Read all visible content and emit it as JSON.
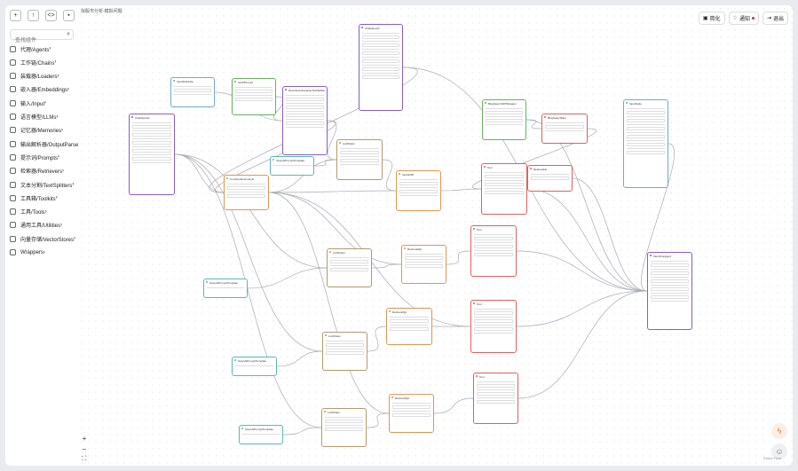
{
  "app": {
    "breadcrumb": "拟股市分析-模拟问题"
  },
  "toolbar_icons": [
    {
      "name": "new-file-icon",
      "glyph": "+"
    },
    {
      "name": "upload-file-icon",
      "glyph": "↑"
    },
    {
      "name": "code-icon",
      "glyph": "<>"
    },
    {
      "name": "save-icon",
      "glyph": "▪"
    }
  ],
  "search": {
    "placeholder": "查找组件",
    "value": ""
  },
  "categories": [
    {
      "label": "代理/Agents",
      "icon": "robot-icon"
    },
    {
      "label": "工作链/Chains",
      "icon": "link-icon"
    },
    {
      "label": "装载器/Loaders",
      "icon": "loader-icon"
    },
    {
      "label": "嵌入器/Embeddings",
      "icon": "fingerprint-icon"
    },
    {
      "label": "输入/Input",
      "icon": "input-icon"
    },
    {
      "label": "语言模型/LLMs",
      "icon": "bulb-icon"
    },
    {
      "label": "记忆器/Memories",
      "icon": "memory-icon"
    },
    {
      "label": "输出解析器/OutputParser",
      "icon": "parser-icon"
    },
    {
      "label": "提示词/Prompts",
      "icon": "prompt-icon"
    },
    {
      "label": "检索器/Retrievers",
      "icon": "retriever-icon"
    },
    {
      "label": "文本分割/TextSplitters",
      "icon": "scissors-icon"
    },
    {
      "label": "工具箱/Toolkits",
      "icon": "toolkit-icon"
    },
    {
      "label": "工具/Tools",
      "icon": "wrench-icon"
    },
    {
      "label": "通用工具/Utilities",
      "icon": "utility-icon"
    },
    {
      "label": "向量存储/VectorStores",
      "icon": "vectorstore-icon"
    },
    {
      "label": "Wrappers",
      "icon": "wrapper-icon"
    }
  ],
  "top_buttons": [
    {
      "label": "简化",
      "icon": "simplify-icon",
      "glyph": "▣"
    },
    {
      "label": "通知",
      "icon": "bell-icon",
      "glyph": "♢"
    },
    {
      "label": "退出",
      "icon": "logout-icon",
      "glyph": "⇥"
    }
  ],
  "zoom": {
    "in": "+",
    "out": "−",
    "fit": "⛶"
  },
  "footer": {
    "brand": "React Flow"
  },
  "colors": {
    "purple": "#8a5cc7",
    "teal": "#5ab8b8",
    "green": "#62b55a",
    "brown": "#b39a6a",
    "orange": "#e39550",
    "red": "#e06060",
    "blue": "#70aacc",
    "edge": "#a8acb3"
  },
  "nodes": [
    {
      "title": "InputFileNode",
      "color": "blue"
    },
    {
      "title": "SerPIPrompt",
      "color": "green"
    },
    {
      "title": "RecursiveCharacterTextSplitter",
      "color": "purple"
    },
    {
      "title": "ChatOpenAI",
      "color": "purple"
    },
    {
      "title": "ChatOpenAI",
      "color": "purple"
    },
    {
      "title": "CombineDocuments",
      "color": "orange"
    },
    {
      "title": "OpenAIPromptTemplate",
      "color": "teal"
    },
    {
      "title": "LLMChain",
      "color": "brown"
    },
    {
      "title": "BingSearchAPIWrapper",
      "color": "green"
    },
    {
      "title": "BingSearchRun",
      "color": "red"
    },
    {
      "title": "InputNode",
      "color": "blue"
    },
    {
      "title": "VectorDB",
      "color": "orange"
    },
    {
      "title": "Tool",
      "color": "red"
    },
    {
      "title": "Retrievable",
      "color": "red"
    },
    {
      "title": "LLMChain",
      "color": "brown"
    },
    {
      "title": "RetrievalQA",
      "color": "orange"
    },
    {
      "title": "Tool",
      "color": "red"
    },
    {
      "title": "OpenAIPromptTemplate",
      "color": "teal"
    },
    {
      "title": "ZeroShotAgent",
      "color": "purple"
    },
    {
      "title": "RetrievalQA",
      "color": "orange"
    },
    {
      "title": "Tool",
      "color": "red"
    },
    {
      "title": "LLMChain",
      "color": "brown"
    },
    {
      "title": "OpenAIPromptTemplate",
      "color": "teal"
    },
    {
      "title": "RetrievalQA",
      "color": "orange"
    },
    {
      "title": "Tool",
      "color": "red"
    },
    {
      "title": "LLMChain",
      "color": "brown"
    },
    {
      "title": "OpenAIPromptTemplate",
      "color": "teal"
    }
  ]
}
